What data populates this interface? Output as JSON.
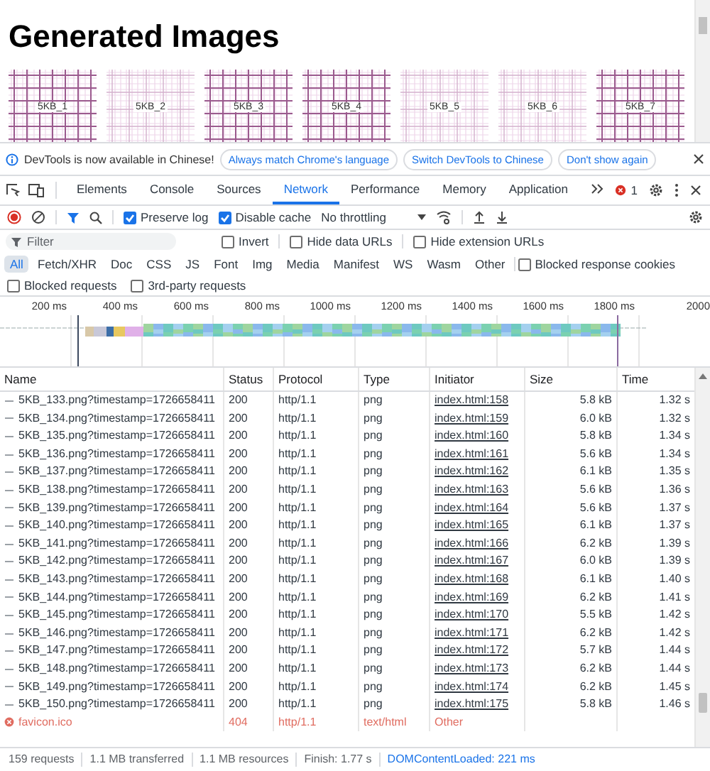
{
  "page": {
    "heading": "Generated Images",
    "thumbnails": [
      "5KB_1",
      "5KB_2",
      "5KB_3",
      "5KB_4",
      "5KB_5",
      "5KB_6",
      "5KB_7"
    ]
  },
  "infobar": {
    "message": "DevTools is now available in Chinese!",
    "buttons": [
      "Always match Chrome's language",
      "Switch DevTools to Chinese",
      "Don't show again"
    ]
  },
  "tabs": [
    {
      "label": "Elements",
      "selected": false
    },
    {
      "label": "Console",
      "selected": false
    },
    {
      "label": "Sources",
      "selected": false
    },
    {
      "label": "Network",
      "selected": true
    },
    {
      "label": "Performance",
      "selected": false
    },
    {
      "label": "Memory",
      "selected": false
    },
    {
      "label": "Application",
      "selected": false
    }
  ],
  "error_count": "1",
  "toolbar": {
    "recording": true,
    "options": [
      {
        "label": "Preserve log",
        "checked": true
      },
      {
        "label": "Disable cache",
        "checked": true
      }
    ],
    "throttling": "No throttling"
  },
  "filter": {
    "placeholder": "Filter",
    "options": [
      {
        "label": "Invert",
        "checked": false
      },
      {
        "label": "Hide data URLs",
        "checked": false
      },
      {
        "label": "Hide extension URLs",
        "checked": false
      }
    ]
  },
  "type_filters": [
    {
      "label": "All",
      "selected": true
    },
    {
      "label": "Fetch/XHR",
      "selected": false
    },
    {
      "label": "Doc",
      "selected": false
    },
    {
      "label": "CSS",
      "selected": false
    },
    {
      "label": "JS",
      "selected": false
    },
    {
      "label": "Font",
      "selected": false
    },
    {
      "label": "Img",
      "selected": false
    },
    {
      "label": "Media",
      "selected": false
    },
    {
      "label": "Manifest",
      "selected": false
    },
    {
      "label": "WS",
      "selected": false
    },
    {
      "label": "Wasm",
      "selected": false
    },
    {
      "label": "Other",
      "selected": false
    }
  ],
  "extra_options": [
    {
      "label": "Blocked response cookies",
      "checked": false
    },
    {
      "label": "Blocked requests",
      "checked": false
    },
    {
      "label": "3rd-party requests",
      "checked": false
    }
  ],
  "timeline": {
    "ticks": [
      "200 ms",
      "400 ms",
      "600 ms",
      "800 ms",
      "1000 ms",
      "1200 ms",
      "1400 ms",
      "1600 ms",
      "1800 ms",
      "2000"
    ]
  },
  "table": {
    "columns": [
      "Name",
      "Status",
      "Protocol",
      "Type",
      "Initiator",
      "Size",
      "Time"
    ],
    "rows": [
      {
        "name": "5KB_133.png?timestamp=1726658411",
        "status": "200",
        "protocol": "http/1.1",
        "type": "png",
        "initiator": "index.html:158",
        "size": "5.8 kB",
        "time": "1.32 s",
        "error": false
      },
      {
        "name": "5KB_134.png?timestamp=1726658411",
        "status": "200",
        "protocol": "http/1.1",
        "type": "png",
        "initiator": "index.html:159",
        "size": "6.0 kB",
        "time": "1.32 s",
        "error": false
      },
      {
        "name": "5KB_135.png?timestamp=1726658411",
        "status": "200",
        "protocol": "http/1.1",
        "type": "png",
        "initiator": "index.html:160",
        "size": "5.8 kB",
        "time": "1.34 s",
        "error": false
      },
      {
        "name": "5KB_136.png?timestamp=1726658411",
        "status": "200",
        "protocol": "http/1.1",
        "type": "png",
        "initiator": "index.html:161",
        "size": "5.6 kB",
        "time": "1.34 s",
        "error": false
      },
      {
        "name": "5KB_137.png?timestamp=1726658411",
        "status": "200",
        "protocol": "http/1.1",
        "type": "png",
        "initiator": "index.html:162",
        "size": "6.1 kB",
        "time": "1.35 s",
        "error": false
      },
      {
        "name": "5KB_138.png?timestamp=1726658411",
        "status": "200",
        "protocol": "http/1.1",
        "type": "png",
        "initiator": "index.html:163",
        "size": "5.6 kB",
        "time": "1.36 s",
        "error": false
      },
      {
        "name": "5KB_139.png?timestamp=1726658411",
        "status": "200",
        "protocol": "http/1.1",
        "type": "png",
        "initiator": "index.html:164",
        "size": "5.6 kB",
        "time": "1.37 s",
        "error": false
      },
      {
        "name": "5KB_140.png?timestamp=1726658411",
        "status": "200",
        "protocol": "http/1.1",
        "type": "png",
        "initiator": "index.html:165",
        "size": "6.1 kB",
        "time": "1.37 s",
        "error": false
      },
      {
        "name": "5KB_141.png?timestamp=1726658411",
        "status": "200",
        "protocol": "http/1.1",
        "type": "png",
        "initiator": "index.html:166",
        "size": "6.2 kB",
        "time": "1.39 s",
        "error": false
      },
      {
        "name": "5KB_142.png?timestamp=1726658411",
        "status": "200",
        "protocol": "http/1.1",
        "type": "png",
        "initiator": "index.html:167",
        "size": "6.0 kB",
        "time": "1.39 s",
        "error": false
      },
      {
        "name": "5KB_143.png?timestamp=1726658411",
        "status": "200",
        "protocol": "http/1.1",
        "type": "png",
        "initiator": "index.html:168",
        "size": "6.1 kB",
        "time": "1.40 s",
        "error": false
      },
      {
        "name": "5KB_144.png?timestamp=1726658411",
        "status": "200",
        "protocol": "http/1.1",
        "type": "png",
        "initiator": "index.html:169",
        "size": "6.2 kB",
        "time": "1.41 s",
        "error": false
      },
      {
        "name": "5KB_145.png?timestamp=1726658411",
        "status": "200",
        "protocol": "http/1.1",
        "type": "png",
        "initiator": "index.html:170",
        "size": "5.5 kB",
        "time": "1.42 s",
        "error": false
      },
      {
        "name": "5KB_146.png?timestamp=1726658411",
        "status": "200",
        "protocol": "http/1.1",
        "type": "png",
        "initiator": "index.html:171",
        "size": "6.2 kB",
        "time": "1.42 s",
        "error": false
      },
      {
        "name": "5KB_147.png?timestamp=1726658411",
        "status": "200",
        "protocol": "http/1.1",
        "type": "png",
        "initiator": "index.html:172",
        "size": "5.7 kB",
        "time": "1.44 s",
        "error": false
      },
      {
        "name": "5KB_148.png?timestamp=1726658411",
        "status": "200",
        "protocol": "http/1.1",
        "type": "png",
        "initiator": "index.html:173",
        "size": "6.2 kB",
        "time": "1.44 s",
        "error": false
      },
      {
        "name": "5KB_149.png?timestamp=1726658411",
        "status": "200",
        "protocol": "http/1.1",
        "type": "png",
        "initiator": "index.html:174",
        "size": "6.2 kB",
        "time": "1.45 s",
        "error": false
      },
      {
        "name": "5KB_150.png?timestamp=1726658411",
        "status": "200",
        "protocol": "http/1.1",
        "type": "png",
        "initiator": "index.html:175",
        "size": "5.8 kB",
        "time": "1.46 s",
        "error": false
      },
      {
        "name": "favicon.ico",
        "status": "404",
        "protocol": "http/1.1",
        "type": "text/html",
        "initiator": "Other",
        "error": true
      }
    ]
  },
  "status_bar": [
    {
      "text": "159 requests",
      "color": "#5f6368"
    },
    {
      "text": "1.1 MB transferred",
      "color": "#5f6368"
    },
    {
      "text": "1.1 MB resources",
      "color": "#5f6368"
    },
    {
      "text": "Finish: 1.77 s",
      "color": "#5f6368"
    },
    {
      "text": "DOMContentLoaded: 221 ms",
      "color": "#1a73e8"
    }
  ]
}
